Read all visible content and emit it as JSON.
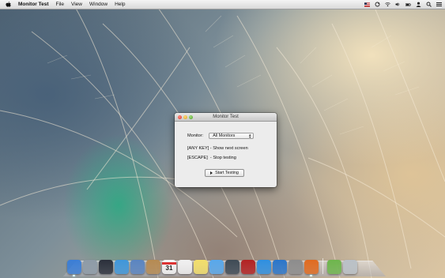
{
  "menubar": {
    "app_name": "Monitor Test",
    "items": [
      "File",
      "View",
      "Window",
      "Help"
    ],
    "status_icons": [
      "flag-icon",
      "sync-icon",
      "wifi-icon",
      "volume-icon",
      "battery-icon",
      "user-icon",
      "search-icon",
      "list-icon"
    ]
  },
  "window": {
    "title": "Monitor Test",
    "monitor_label": "Monitor:",
    "monitor_value": "All Monitors",
    "line1": "[ANY KEY] - Show next screen",
    "line2": "[ESCAPE]  - Stop testing",
    "start_button": "Start Testing"
  },
  "dock": {
    "apps": [
      {
        "icon": "finder-icon",
        "color": "#3b7ed6"
      },
      {
        "icon": "launchpad-icon",
        "color": "#8d9aa6"
      },
      {
        "icon": "mission-control-icon",
        "color": "#2a2f3a"
      },
      {
        "icon": "safari-icon",
        "color": "#3f96d9"
      },
      {
        "icon": "mail-icon",
        "color": "#5a84c0"
      },
      {
        "icon": "contacts-icon",
        "color": "#b58a52"
      },
      {
        "icon": "calendar-icon",
        "color": "#f5f5f5"
      },
      {
        "icon": "reminders-icon",
        "color": "#f0f0f0"
      },
      {
        "icon": "notes-icon",
        "color": "#f2de6b"
      },
      {
        "icon": "messages-icon",
        "color": "#58a7ea"
      },
      {
        "icon": "facetime-icon",
        "color": "#3e4a55"
      },
      {
        "icon": "photo-booth-icon",
        "color": "#b22222"
      },
      {
        "icon": "itunes-icon",
        "color": "#2e8fe0"
      },
      {
        "icon": "app-store-icon",
        "color": "#2a75c9"
      },
      {
        "icon": "system-preferences-icon",
        "color": "#8c8c8c"
      },
      {
        "icon": "monitor-test-icon",
        "color": "#e06a1f"
      }
    ],
    "calendar_day": "31",
    "trailing": [
      {
        "icon": "downloads-icon",
        "color": "#6db54c"
      },
      {
        "icon": "trash-icon",
        "color": "#b9c0c6"
      }
    ]
  }
}
